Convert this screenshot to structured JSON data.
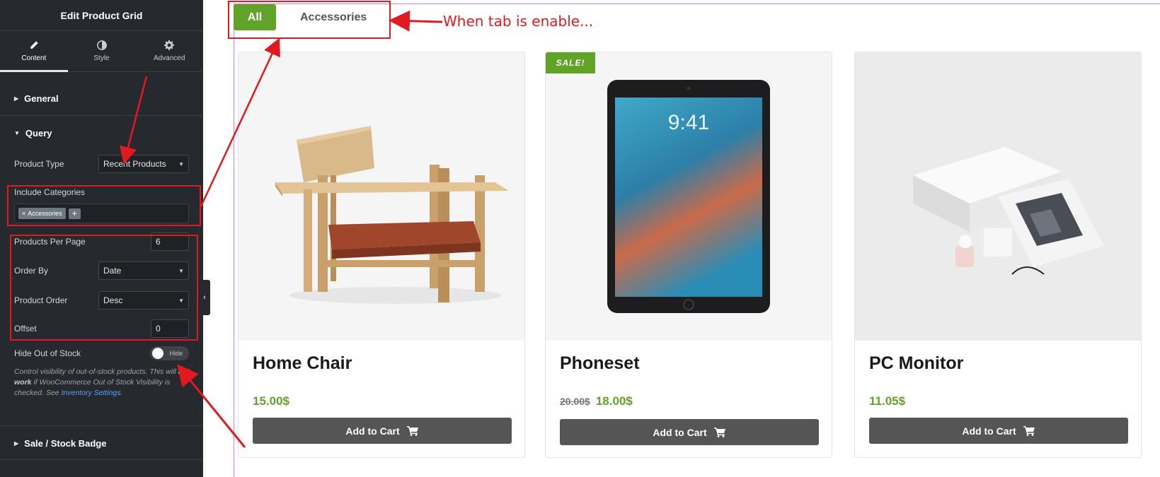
{
  "sidebar": {
    "title": "Edit Product Grid",
    "tabs": [
      {
        "label": "Content",
        "icon": "pencil-icon"
      },
      {
        "label": "Style",
        "icon": "contrast-icon"
      },
      {
        "label": "Advanced",
        "icon": "gear-icon"
      }
    ],
    "sections": {
      "general": "General",
      "query": "Query",
      "sale_badge": "Sale / Stock Badge"
    },
    "query": {
      "product_type_label": "Product Type",
      "product_type_value": "Recent Products",
      "include_categories_label": "Include Categories",
      "category_tag": "Accessories",
      "category_tag_remove": "×",
      "add_tag": "+",
      "per_page_label": "Products Per Page",
      "per_page_value": "6",
      "order_by_label": "Order By",
      "order_by_value": "Date",
      "product_order_label": "Product Order",
      "product_order_value": "Desc",
      "offset_label": "Offset",
      "offset_value": "0",
      "hide_oos_label": "Hide Out of Stock",
      "hide_oos_toggle": "Hide",
      "help_pre": "Control visibility of out-of-stock products. This will",
      "help_bold": "not work",
      "help_mid": " if WooCommerce Out of Stock Visibility is checked. See ",
      "help_link": "Inventory Settings",
      "help_end": "."
    },
    "collapse_glyph": "‹"
  },
  "preview": {
    "tabs": [
      {
        "label": "All",
        "active": true
      },
      {
        "label": "Accessories",
        "active": false
      }
    ],
    "products": [
      {
        "name": "Home Chair",
        "price": "15.00$",
        "old_price": "",
        "sale": false,
        "cart_label": "Add to Cart"
      },
      {
        "name": "Phoneset",
        "price": "18.00$",
        "old_price": "20.00$",
        "sale": true,
        "cart_label": "Add to Cart"
      },
      {
        "name": "PC Monitor",
        "price": "11.05$",
        "old_price": "",
        "sale": false,
        "cart_label": "Add to Cart"
      }
    ],
    "sale_badge": "SALE!"
  },
  "annotation": {
    "note": "When tab is enable..."
  },
  "colors": {
    "accent_green": "#61a229",
    "annotation_red": "#e2191e",
    "sidebar_bg": "#26292e",
    "button_gray": "#555555"
  }
}
